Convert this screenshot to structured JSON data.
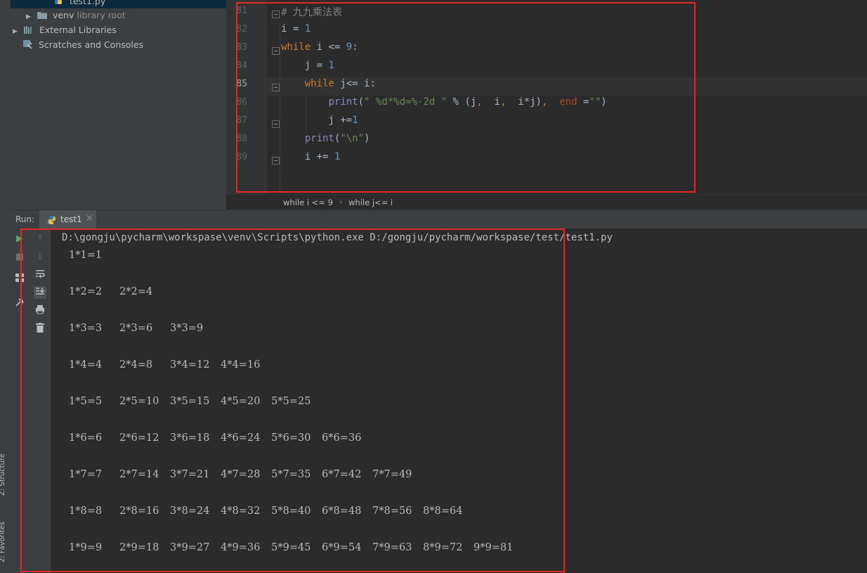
{
  "project_tree": {
    "file_item": "test1.py",
    "venv": {
      "name": "venv",
      "suffix": "library root"
    },
    "external_libraries": "External Libraries",
    "scratches": "Scratches and Consoles"
  },
  "side_tabs": {
    "structure": "Z: Structure",
    "favorites": "2: Favorites"
  },
  "editor": {
    "lines": [
      {
        "n": "81",
        "tokens": [
          {
            "t": "# 九九乘法表",
            "c": "cm"
          }
        ]
      },
      {
        "n": "82",
        "tokens": [
          {
            "t": "i = ",
            "c": "id"
          },
          {
            "t": "1",
            "c": "num"
          }
        ]
      },
      {
        "n": "83",
        "tokens": [
          {
            "t": "while",
            "c": "kw"
          },
          {
            "t": " i <= ",
            "c": "id"
          },
          {
            "t": "9",
            "c": "num"
          },
          {
            "t": ":",
            "c": "id"
          }
        ]
      },
      {
        "n": "84",
        "tokens": [
          {
            "t": "    j = ",
            "c": "id"
          },
          {
            "t": "1",
            "c": "num"
          }
        ]
      },
      {
        "n": "85",
        "tokens": [
          {
            "t": "    ",
            "c": "id"
          },
          {
            "t": "while",
            "c": "kw"
          },
          {
            "t": " j<= i:",
            "c": "id"
          }
        ]
      },
      {
        "n": "86",
        "tokens": [
          {
            "t": "        ",
            "c": "id"
          },
          {
            "t": "print",
            "c": "fn"
          },
          {
            "t": "(",
            "c": "id"
          },
          {
            "t": "\" %d*%d=%-2d \"",
            "c": "str"
          },
          {
            "t": " % (j",
            "c": "id"
          },
          {
            "t": ",",
            "c": "kw"
          },
          {
            "t": "  i",
            "c": "id"
          },
          {
            "t": ",",
            "c": "kw"
          },
          {
            "t": "  i*j)",
            "c": "id"
          },
          {
            "t": ",",
            "c": "kw"
          },
          {
            "t": "  ",
            "c": "id"
          },
          {
            "t": "end",
            "c": "arg"
          },
          {
            "t": " =",
            "c": "id"
          },
          {
            "t": "\"\"",
            "c": "str"
          },
          {
            "t": ")",
            "c": "id"
          }
        ]
      },
      {
        "n": "87",
        "tokens": [
          {
            "t": "        j +=",
            "c": "id"
          },
          {
            "t": "1",
            "c": "num"
          }
        ]
      },
      {
        "n": "88",
        "tokens": [
          {
            "t": "    ",
            "c": "id"
          },
          {
            "t": "print",
            "c": "fn"
          },
          {
            "t": "(",
            "c": "id"
          },
          {
            "t": "\"\\n\"",
            "c": "str"
          },
          {
            "t": ")",
            "c": "id"
          }
        ]
      },
      {
        "n": "89",
        "tokens": [
          {
            "t": "    i += ",
            "c": "id"
          },
          {
            "t": "1",
            "c": "num"
          }
        ]
      }
    ],
    "current_line": "85"
  },
  "breadcrumb": {
    "part1": "while i <= 9",
    "sep": "›",
    "part2": "while j<= i"
  },
  "run": {
    "label": "Run:",
    "tab_name": "test1",
    "close": "×"
  },
  "console": {
    "command": "D:\\gongju\\pycharm\\workspase\\venv\\Scripts\\python.exe D:/gongju/pycharm/workspase/test/test1.py",
    "rows": [
      [
        "1*1=1"
      ],
      [
        "1*2=2",
        "2*2=4"
      ],
      [
        "1*3=3",
        "2*3=6",
        "3*3=9"
      ],
      [
        "1*4=4",
        "2*4=8",
        "3*4=12",
        "4*4=16"
      ],
      [
        "1*5=5",
        "2*5=10",
        "3*5=15",
        "4*5=20",
        "5*5=25"
      ],
      [
        "1*6=6",
        "2*6=12",
        "3*6=18",
        "4*6=24",
        "5*6=30",
        "6*6=36"
      ],
      [
        "1*7=7",
        "2*7=14",
        "3*7=21",
        "4*7=28",
        "5*7=35",
        "6*7=42",
        "7*7=49"
      ],
      [
        "1*8=8",
        "2*8=16",
        "3*8=24",
        "4*8=32",
        "5*8=40",
        "6*8=48",
        "7*8=56",
        "8*8=64"
      ],
      [
        "1*9=9",
        "2*9=18",
        "3*9=27",
        "4*9=36",
        "5*9=45",
        "6*9=54",
        "7*9=63",
        "8*9=72",
        "9*9=81"
      ]
    ]
  },
  "colors": {
    "highlight": "#e8262a",
    "keyword": "#cc7832",
    "number": "#6897bb",
    "string": "#6a8759",
    "comment": "#808080",
    "builtin": "#8888c6"
  }
}
